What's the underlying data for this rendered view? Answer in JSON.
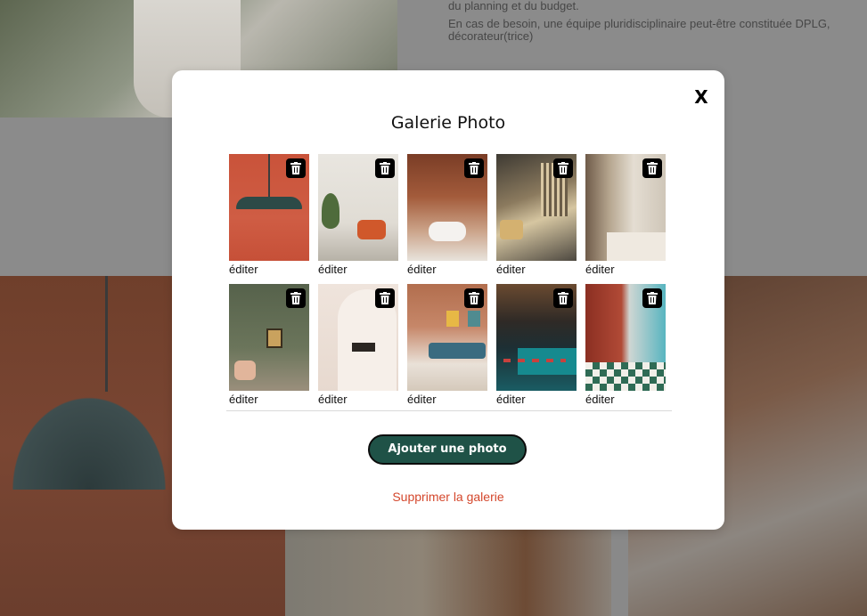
{
  "background": {
    "text_paragraph_1": "du planning et du budget.",
    "text_paragraph_2": "En cas de besoin, une équipe pluridisciplinaire peut-être constituée DPLG, décorateur(trice)"
  },
  "modal": {
    "close_label": "X",
    "title": "Galerie Photo",
    "photos": [
      {
        "edit_label": "éditer",
        "icon": "trash-icon"
      },
      {
        "edit_label": "éditer",
        "icon": "trash-icon"
      },
      {
        "edit_label": "éditer",
        "icon": "trash-icon"
      },
      {
        "edit_label": "éditer",
        "icon": "trash-icon"
      },
      {
        "edit_label": "éditer",
        "icon": "trash-icon"
      },
      {
        "edit_label": "éditer",
        "icon": "trash-icon"
      },
      {
        "edit_label": "éditer",
        "icon": "trash-icon"
      },
      {
        "edit_label": "éditer",
        "icon": "trash-icon"
      },
      {
        "edit_label": "éditer",
        "icon": "trash-icon"
      },
      {
        "edit_label": "éditer",
        "icon": "trash-icon"
      }
    ],
    "add_button_label": "Ajouter une photo",
    "delete_gallery_label": "Supprimer la galerie"
  },
  "colors": {
    "accent_button": "#1f5247",
    "danger_text": "#d4472c",
    "delete_icon_bg": "#000000"
  }
}
